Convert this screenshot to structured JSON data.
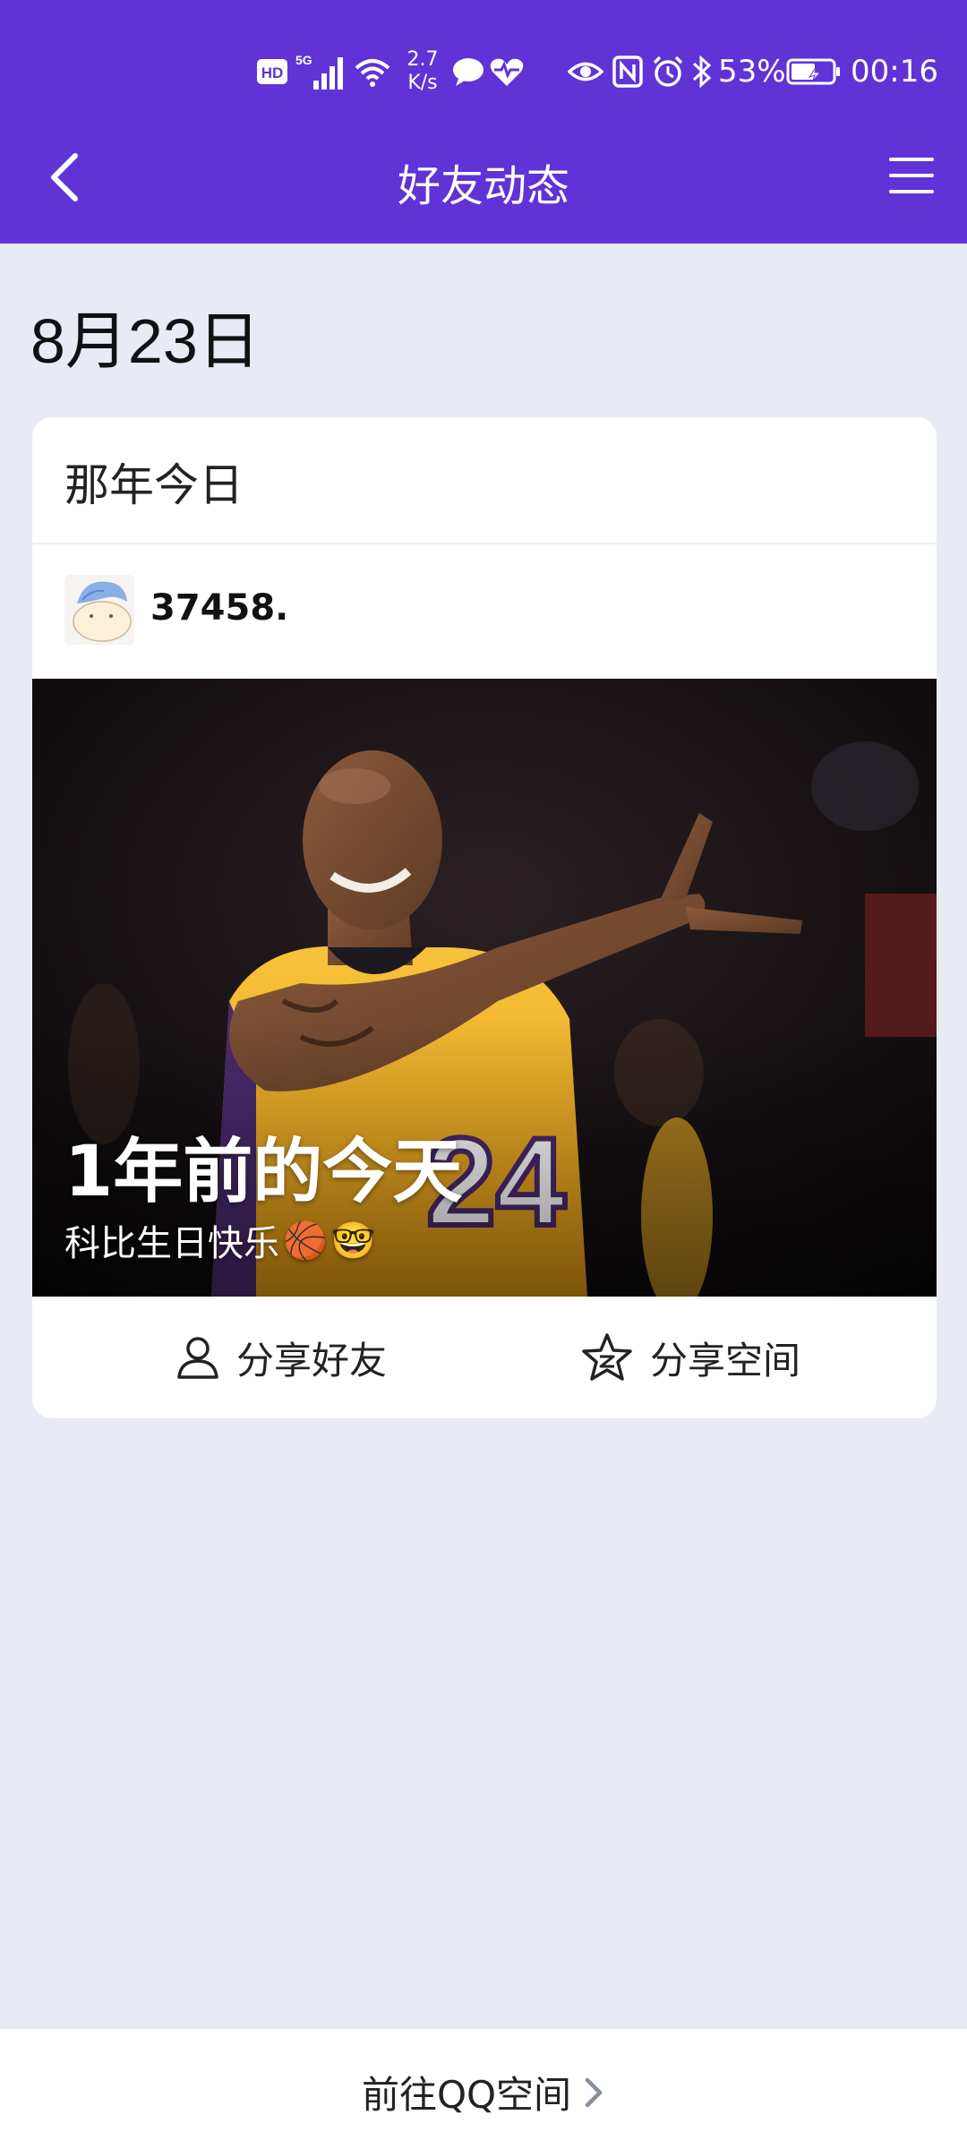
{
  "status_bar": {
    "hd_label": "HD",
    "signal_label": "5G",
    "net_speed_value": "2.7",
    "net_speed_unit": "K/s",
    "battery_percent": "53%",
    "time": "00:16",
    "icons": [
      "hd-icon",
      "signal-5g-icon",
      "wifi-icon",
      "chat-bubble-icon",
      "heart-monitor-icon",
      "eye-icon",
      "nfc-icon",
      "alarm-icon",
      "bluetooth-icon",
      "battery-icon"
    ]
  },
  "nav": {
    "title": "好友动态",
    "back_icon": "chevron-left-icon",
    "menu_icon": "menu-icon"
  },
  "date_heading": "8月23日",
  "card": {
    "title": "那年今日",
    "username": "37458.",
    "memory_title": "1年前的今天",
    "memory_caption": "科比生日快乐",
    "caption_emojis": [
      "🏀",
      "🤓"
    ],
    "actions": [
      {
        "label": "分享好友",
        "icon": "person-icon"
      },
      {
        "label": "分享空间",
        "icon": "qzone-star-icon"
      }
    ]
  },
  "footer": {
    "link_label": "前往QQ空间",
    "chevron_icon": "chevron-right-icon"
  },
  "colors": {
    "header_bg": "#6132d6",
    "page_bg": "#e8eaf4",
    "card_bg": "#ffffff",
    "jersey": "#f2b01e"
  }
}
